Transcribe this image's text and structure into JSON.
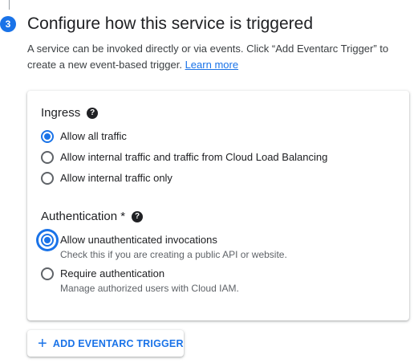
{
  "step": {
    "number": "3",
    "title": "Configure how this service is triggered"
  },
  "description": {
    "text": "A service can be invoked directly or via events. Click “Add Eventarc Trigger” to create a new event-based trigger.",
    "link": "Learn more"
  },
  "ingress": {
    "title": "Ingress",
    "options": [
      {
        "label": "Allow all traffic",
        "checked": true
      },
      {
        "label": "Allow internal traffic and traffic from Cloud Load Balancing",
        "checked": false
      },
      {
        "label": "Allow internal traffic only",
        "checked": false
      }
    ]
  },
  "authentication": {
    "title": "Authentication *",
    "options": [
      {
        "label": "Allow unauthenticated invocations",
        "sub": "Check this if you are creating a public API or website.",
        "checked": true
      },
      {
        "label": "Require authentication",
        "sub": "Manage authorized users with Cloud IAM.",
        "checked": false
      }
    ]
  },
  "add_trigger": {
    "icon": "plus-icon",
    "label": "ADD EVENTARC TRIGGER"
  },
  "colors": {
    "accent": "#1a73e8",
    "text": "#202124",
    "secondary": "#5f6368"
  }
}
